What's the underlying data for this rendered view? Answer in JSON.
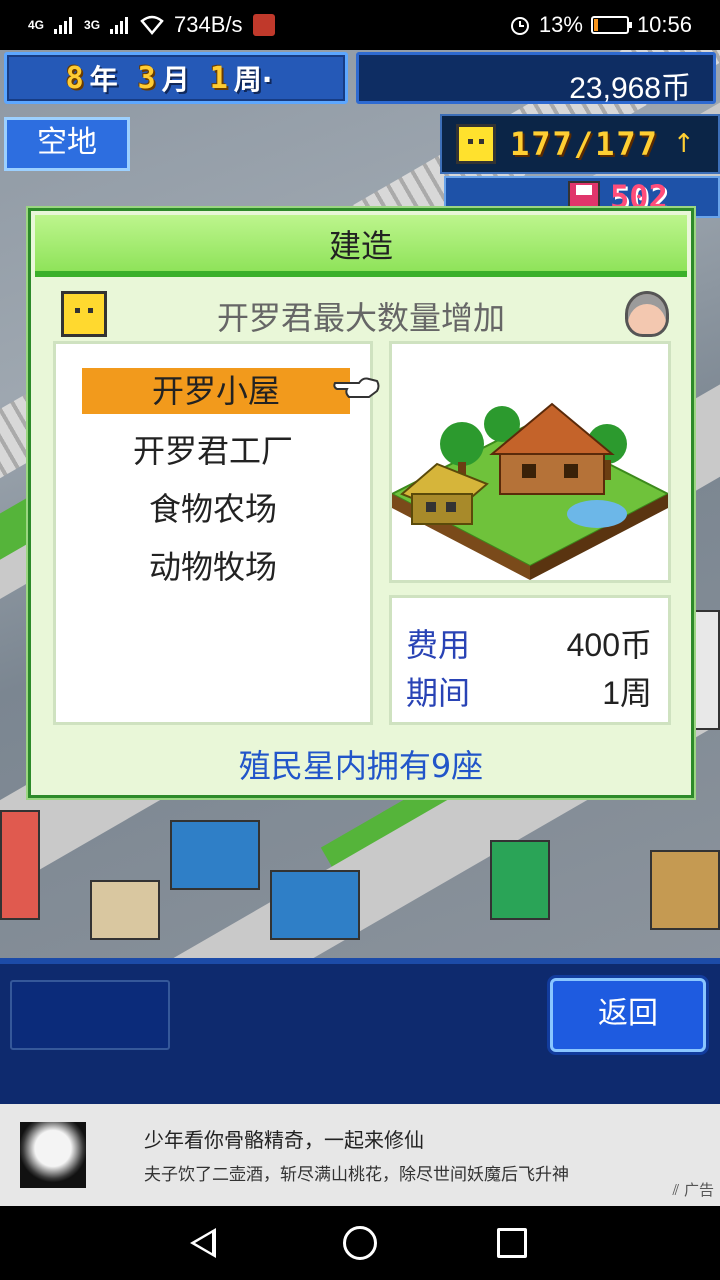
{
  "status_bar": {
    "network_1": "4G",
    "network_2": "3G",
    "speed": "734B/s",
    "battery": "13%",
    "battery_level_pct": 13,
    "time": "10:56"
  },
  "hud": {
    "year_num": "8",
    "year_unit": "年",
    "month_num": "3",
    "month_unit": "月",
    "week_num": "1",
    "week_unit": "周·",
    "money": "23,968币",
    "lot_label": "空地",
    "population": "177/177",
    "population_arrow": "↑",
    "storage": "502"
  },
  "dialog": {
    "title": "建造",
    "subtitle": "开罗君最大数量增加",
    "items": [
      {
        "label": "开罗小屋",
        "selected": true
      },
      {
        "label": "开罗君工厂",
        "selected": false
      },
      {
        "label": "食物农场",
        "selected": false
      },
      {
        "label": "动物牧场",
        "selected": false
      }
    ],
    "cost_label": "费用",
    "cost_value": "400币",
    "period_label": "期间",
    "period_value": "1周",
    "owned_text": "殖民星内拥有9座"
  },
  "bottom": {
    "back_label": "返回"
  },
  "ad": {
    "title": "少年看你骨骼精奇，一起来修仙",
    "description": "夫子饮了二壶酒，斩尽满山桃花，除尽世间妖魔后飞升神仙",
    "tag": "广告"
  },
  "colors": {
    "selection": "#f29a1c",
    "dialog_bg": "#e9f7d8",
    "title_green": "#8fe35a",
    "hud_blue": "#2559b7",
    "owned_text": "#2155c9"
  }
}
